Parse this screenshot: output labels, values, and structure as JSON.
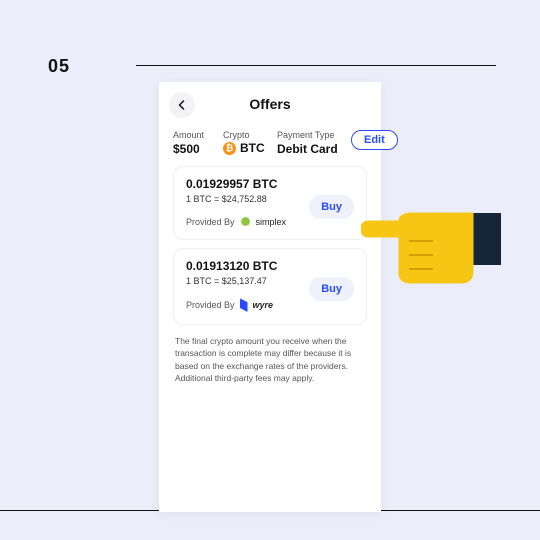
{
  "step_number": "05",
  "header": {
    "title": "Offers"
  },
  "summary": {
    "amount_label": "Amount",
    "amount_value": "$500",
    "crypto_label": "Crypto",
    "crypto_value": "BTC",
    "payment_label": "Payment Type",
    "payment_value": "Debit Card",
    "edit_label": "Edit"
  },
  "offers": [
    {
      "quantity": "0.01929957 BTC",
      "rate": "1 BTC = $24,752.88",
      "provided_by_label": "Provided By",
      "provider_name": "simplex",
      "buy_label": "Buy"
    },
    {
      "quantity": "0.01913120 BTC",
      "rate": "1 BTC = $25,137.47",
      "provided_by_label": "Provided By",
      "provider_name": "wyre",
      "buy_label": "Buy"
    }
  ],
  "disclaimer_line1": "The final crypto amount you receive when the transaction is complete may differ because it is based on the exchange rates of the providers.",
  "disclaimer_line2": "Additional third-party fees may apply."
}
